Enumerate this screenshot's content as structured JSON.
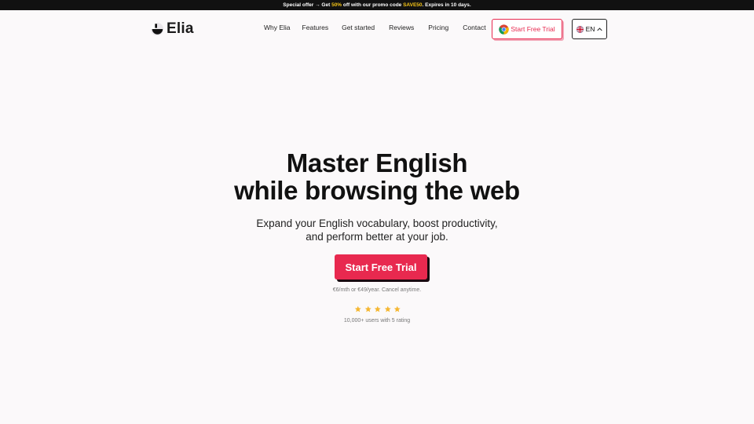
{
  "promo": {
    "prefix": "Special offer → Get ",
    "discount": "50%",
    "middle": " off with our promo code ",
    "code": "SAVE50",
    "suffix": ". Expires in 10 days."
  },
  "brand": {
    "name": "Elia"
  },
  "nav": {
    "links": [
      "Why Elia",
      "Features",
      "Get started",
      "Reviews",
      "Pricing",
      "Contact"
    ],
    "cta_label": "Start Free Trial",
    "language": "EN"
  },
  "hero": {
    "title_line1": "Master English",
    "title_line2": "while browsing the web",
    "subtitle_line1": "Expand your English vocabulary, boost productivity,",
    "subtitle_line2": "and perform better at your job.",
    "cta_label": "Start Free Trial",
    "pricing_note": "€6/mth or €49/year. Cancel anytime.",
    "rating": 5,
    "rating_note": "10,000+ users with 5 rating"
  },
  "colors": {
    "accent": "#e8294f",
    "star": "#f5b731",
    "promo_highlight": "#f5c518"
  },
  "icons": {
    "browser": "chrome-icon",
    "language": "uk-flag-icon",
    "caret": "chevron-up-icon",
    "rating": "star-icon"
  }
}
